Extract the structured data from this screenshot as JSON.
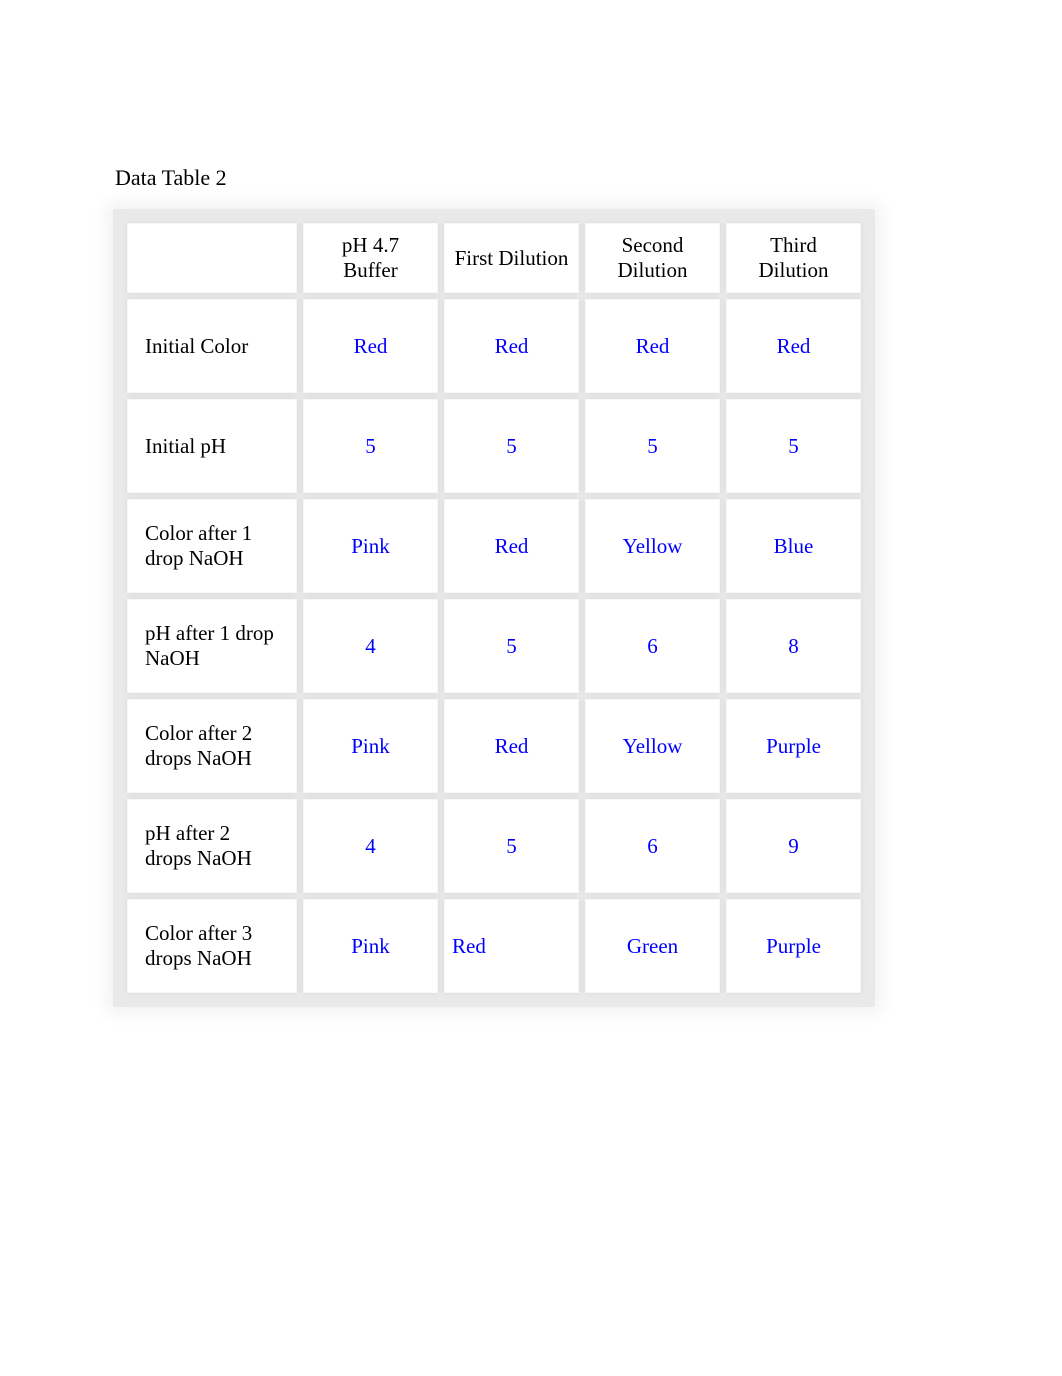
{
  "title": "Data Table 2",
  "headers": {
    "blank": "",
    "c1": "pH 4.7 Buffer",
    "c2": "First Dilution",
    "c3": "Second Dilution",
    "c4": "Third Dilution"
  },
  "rows": [
    {
      "label": "Initial Color",
      "c1": "Red",
      "c2": "Red",
      "c3": "Red",
      "c4": "Red"
    },
    {
      "label": "Initial pH",
      "c1": "5",
      "c2": "5",
      "c3": "5",
      "c4": "5"
    },
    {
      "label": "Color after 1 drop NaOH",
      "c1": "Pink",
      "c2": "Red",
      "c3": "Yellow",
      "c4": "Blue"
    },
    {
      "label": "pH after 1 drop NaOH",
      "c1": "4",
      "c2": "5",
      "c3": "6",
      "c4": "8"
    },
    {
      "label": "Color after 2 drops NaOH",
      "c1": "Pink",
      "c2": "Red",
      "c3": "Yellow",
      "c4": "Purple"
    },
    {
      "label": "pH after 2 drops NaOH",
      "c1": "4",
      "c2": "5",
      "c3": "6",
      "c4": "9"
    },
    {
      "label": "Color after 3 drops NaOH",
      "c1": "Pink",
      "c2": "Red",
      "c3": "Green",
      "c4": "Purple"
    }
  ]
}
